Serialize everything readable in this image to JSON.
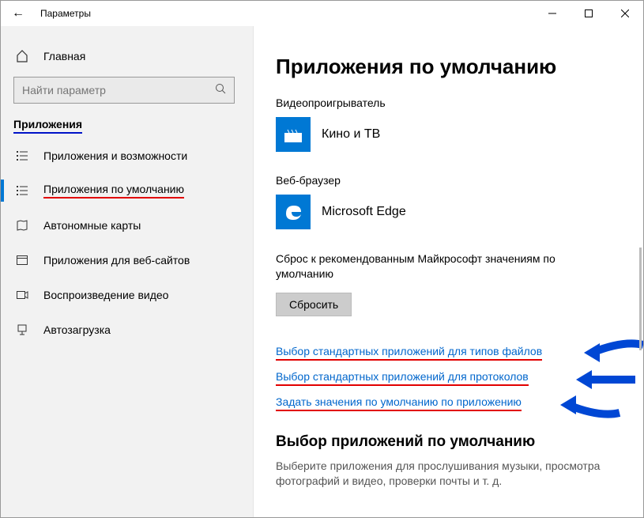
{
  "titlebar": {
    "title": "Параметры"
  },
  "sidebar": {
    "home": "Главная",
    "search_placeholder": "Найти параметр",
    "section": "Приложения",
    "items": [
      {
        "label": "Приложения и возможности"
      },
      {
        "label": "Приложения по умолчанию"
      },
      {
        "label": "Автономные карты"
      },
      {
        "label": "Приложения для веб-сайтов"
      },
      {
        "label": "Воспроизведение видео"
      },
      {
        "label": "Автозагрузка"
      }
    ]
  },
  "main": {
    "heading": "Приложения по умолчанию",
    "video_label": "Видеопроигрыватель",
    "video_app": "Кино и ТВ",
    "browser_label": "Веб-браузер",
    "browser_app": "Microsoft Edge",
    "reset_text": "Сброс к рекомендованным Майкрософт значениям по умолчанию",
    "reset_btn": "Сбросить",
    "links": [
      "Выбор стандартных приложений для типов файлов",
      "Выбор стандартных приложений для протоколов",
      "Задать значения по умолчанию по приложению"
    ],
    "section2_heading": "Выбор приложений по умолчанию",
    "section2_desc": "Выберите приложения для прослушивания музыки, просмотра фотографий и видео, проверки почты и т. д."
  }
}
